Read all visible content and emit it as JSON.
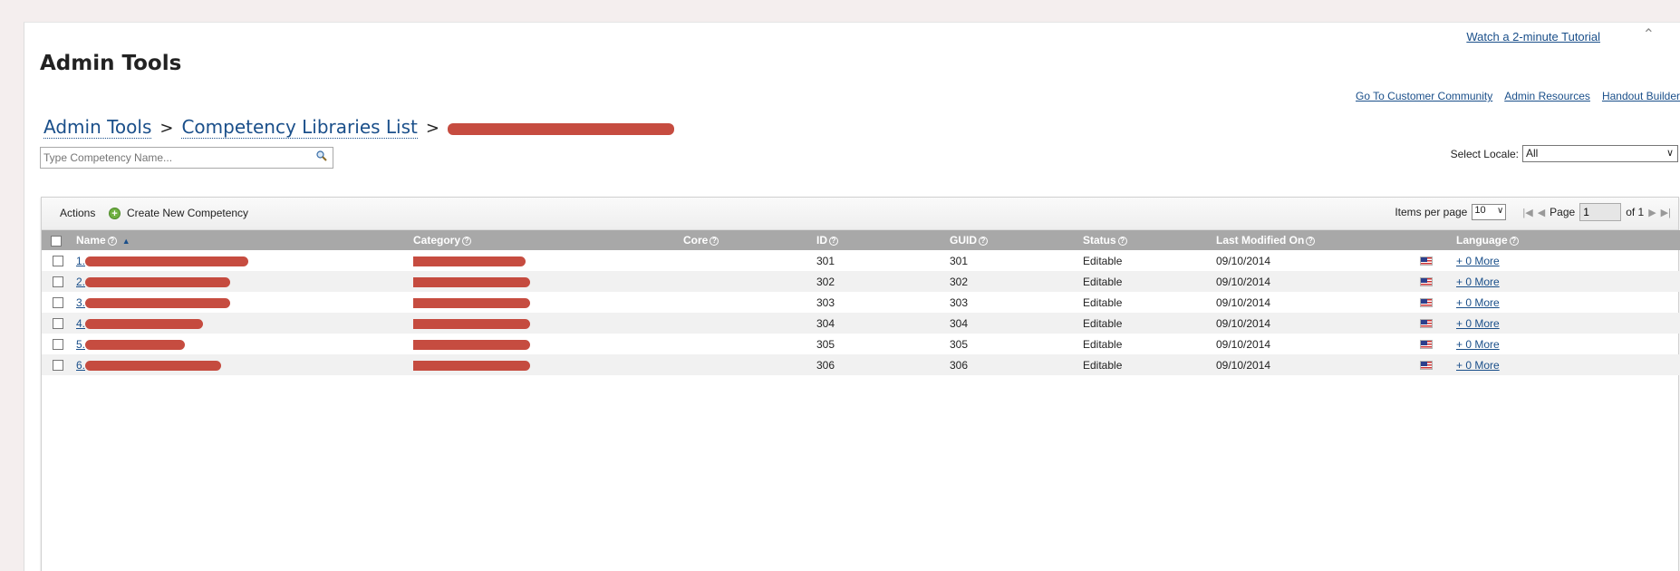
{
  "header": {
    "tutorial_link": "Watch a 2-minute Tutorial",
    "title": "Admin Tools",
    "top_links": [
      "Go To Customer Community",
      "Admin Resources",
      "Handout Builder"
    ]
  },
  "breadcrumb": {
    "items": [
      "Admin Tools",
      "Competency Libraries List"
    ],
    "separator": ">"
  },
  "search": {
    "placeholder": "Type Competency Name..."
  },
  "locale": {
    "label": "Select Locale:",
    "value": "All"
  },
  "toolbar": {
    "actions_label": "Actions",
    "create_label": "Create New Competency",
    "items_per_page_label": "Items per page",
    "items_per_page": "10",
    "page_label": "Page",
    "page_value": "1",
    "of_label": "of 1"
  },
  "table": {
    "columns": [
      "Name",
      "Category",
      "Core",
      "ID",
      "GUID",
      "Status",
      "Last Modified On",
      "Language"
    ],
    "rows": [
      {
        "num": "1.",
        "id": "301",
        "guid": "301",
        "status": "Editable",
        "modified": "09/10/2014",
        "more": "+ 0 More"
      },
      {
        "num": "2.",
        "id": "302",
        "guid": "302",
        "status": "Editable",
        "modified": "09/10/2014",
        "more": "+ 0 More"
      },
      {
        "num": "3.",
        "id": "303",
        "guid": "303",
        "status": "Editable",
        "modified": "09/10/2014",
        "more": "+ 0 More"
      },
      {
        "num": "4.",
        "id": "304",
        "guid": "304",
        "status": "Editable",
        "modified": "09/10/2014",
        "more": "+ 0 More"
      },
      {
        "num": "5.",
        "id": "305",
        "guid": "305",
        "status": "Editable",
        "modified": "09/10/2014",
        "more": "+ 0 More"
      },
      {
        "num": "6.",
        "id": "306",
        "guid": "306",
        "status": "Editable",
        "modified": "09/10/2014",
        "more": "+ 0 More"
      }
    ]
  },
  "colors": {
    "link": "#1a4f8a",
    "header_bg": "#a8a8a8",
    "redaction": "#c0392b"
  }
}
